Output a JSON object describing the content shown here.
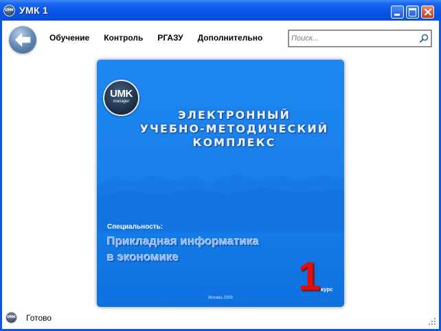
{
  "window": {
    "title": "УМК 1",
    "icon": "umk-app-icon",
    "controls": [
      "minimize-icon",
      "maximize-icon",
      "close-icon"
    ]
  },
  "nav": {
    "back_icon": "back-arrow-icon",
    "items": [
      {
        "label": "Обучение"
      },
      {
        "label": "Контроль"
      },
      {
        "label": "РГАЗУ"
      },
      {
        "label": "Дополнительно"
      }
    ]
  },
  "search": {
    "placeholder": "Поиск...",
    "icon": "magnifier-icon"
  },
  "cover": {
    "logo_main": "UMK",
    "logo_sub": "manager",
    "title_lines": [
      "ЭЛЕКТРОННЫЙ",
      "УЧЕБНО-МЕТОДИЧЕСКИЙ",
      "КОМПЛЕКС"
    ],
    "spec_label": "Специальность:",
    "spec_lines": [
      "Прикладная информатика",
      "в экономике"
    ],
    "course_number": "1",
    "course_label": "курс",
    "footer": "Москва 2009",
    "colors": {
      "background": "#1b82ec",
      "course_number": "#e01010"
    }
  },
  "status": {
    "text": "Готово",
    "icon": "umk-app-icon"
  }
}
